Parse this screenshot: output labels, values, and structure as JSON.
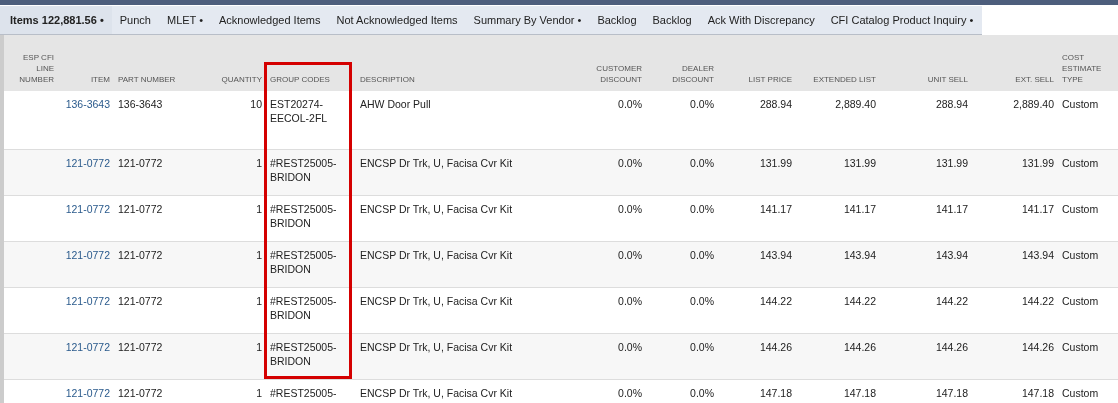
{
  "tabs": [
    {
      "label": "Items 122,881.56 •",
      "selected": true
    },
    {
      "label": "Punch",
      "selected": false
    },
    {
      "label": "MLET •",
      "selected": false
    },
    {
      "label": "Acknowledged Items",
      "selected": false
    },
    {
      "label": "Not Acknowledged Items",
      "selected": false
    },
    {
      "label": "Summary By Vendor •",
      "selected": false
    },
    {
      "label": "Backlog",
      "selected": false
    },
    {
      "label": "Backlog",
      "selected": false
    },
    {
      "label": "Ack With Discrepancy",
      "selected": false
    },
    {
      "label": "CFI Catalog Product Inquiry •",
      "selected": false
    }
  ],
  "table": {
    "columns": [
      {
        "label": "ESP CFI LINE NUMBER",
        "highlighted": false
      },
      {
        "label": "ITEM",
        "highlighted": false
      },
      {
        "label": "PART NUMBER",
        "highlighted": false
      },
      {
        "label": "QUANTITY",
        "highlighted": false
      },
      {
        "label": "GROUP CODES",
        "highlighted": true
      },
      {
        "label": "DESCRIPTION",
        "highlighted": false
      },
      {
        "label": "CUSTOMER DISCOUNT",
        "highlighted": false
      },
      {
        "label": "DEALER DISCOUNT",
        "highlighted": false
      },
      {
        "label": "LIST PRICE",
        "highlighted": false
      },
      {
        "label": "EXTENDED LIST",
        "highlighted": false
      },
      {
        "label": "UNIT SELL",
        "highlighted": false
      },
      {
        "label": "EXT. SELL",
        "highlighted": false
      },
      {
        "label": "COST ESTIMATE TYPE",
        "highlighted": false
      }
    ],
    "rows": [
      {
        "item": "136-3643",
        "part_number": "136-3643",
        "quantity": "10",
        "group_codes": "EST20274-EECOL-2FL",
        "description": "AHW Door Pull",
        "customer_discount": "0.0%",
        "dealer_discount": "0.0%",
        "list_price": "288.94",
        "extended_list": "2,889.40",
        "unit_sell": "288.94",
        "ext_sell": "2,889.40",
        "cost_estimate_type": "Custom"
      },
      {
        "item": "121-0772",
        "part_number": "121-0772",
        "quantity": "1",
        "group_codes": "#REST25005-BRIDON",
        "description": "ENCSP Dr Trk, U, Facisa Cvr Kit",
        "customer_discount": "0.0%",
        "dealer_discount": "0.0%",
        "list_price": "131.99",
        "extended_list": "131.99",
        "unit_sell": "131.99",
        "ext_sell": "131.99",
        "cost_estimate_type": "Custom"
      },
      {
        "item": "121-0772",
        "part_number": "121-0772",
        "quantity": "1",
        "group_codes": "#REST25005-BRIDON",
        "description": "ENCSP Dr Trk, U, Facisa Cvr Kit",
        "customer_discount": "0.0%",
        "dealer_discount": "0.0%",
        "list_price": "141.17",
        "extended_list": "141.17",
        "unit_sell": "141.17",
        "ext_sell": "141.17",
        "cost_estimate_type": "Custom"
      },
      {
        "item": "121-0772",
        "part_number": "121-0772",
        "quantity": "1",
        "group_codes": "#REST25005-BRIDON",
        "description": "ENCSP Dr Trk, U, Facisa Cvr Kit",
        "customer_discount": "0.0%",
        "dealer_discount": "0.0%",
        "list_price": "143.94",
        "extended_list": "143.94",
        "unit_sell": "143.94",
        "ext_sell": "143.94",
        "cost_estimate_type": "Custom"
      },
      {
        "item": "121-0772",
        "part_number": "121-0772",
        "quantity": "1",
        "group_codes": "#REST25005-BRIDON",
        "description": "ENCSP Dr Trk, U, Facisa Cvr Kit",
        "customer_discount": "0.0%",
        "dealer_discount": "0.0%",
        "list_price": "144.22",
        "extended_list": "144.22",
        "unit_sell": "144.22",
        "ext_sell": "144.22",
        "cost_estimate_type": "Custom"
      },
      {
        "item": "121-0772",
        "part_number": "121-0772",
        "quantity": "1",
        "group_codes": "#REST25005-BRIDON",
        "description": "ENCSP Dr Trk, U, Facisa Cvr Kit",
        "customer_discount": "0.0%",
        "dealer_discount": "0.0%",
        "list_price": "144.26",
        "extended_list": "144.26",
        "unit_sell": "144.26",
        "ext_sell": "144.26",
        "cost_estimate_type": "Custom"
      },
      {
        "item": "121-0772",
        "part_number": "121-0772",
        "quantity": "1",
        "group_codes": "#REST25005-",
        "description": "ENCSP Dr Trk, U, Facisa Cvr Kit",
        "customer_discount": "0.0%",
        "dealer_discount": "0.0%",
        "list_price": "147.18",
        "extended_list": "147.18",
        "unit_sell": "147.18",
        "ext_sell": "147.18",
        "cost_estimate_type": "Custom"
      }
    ]
  }
}
